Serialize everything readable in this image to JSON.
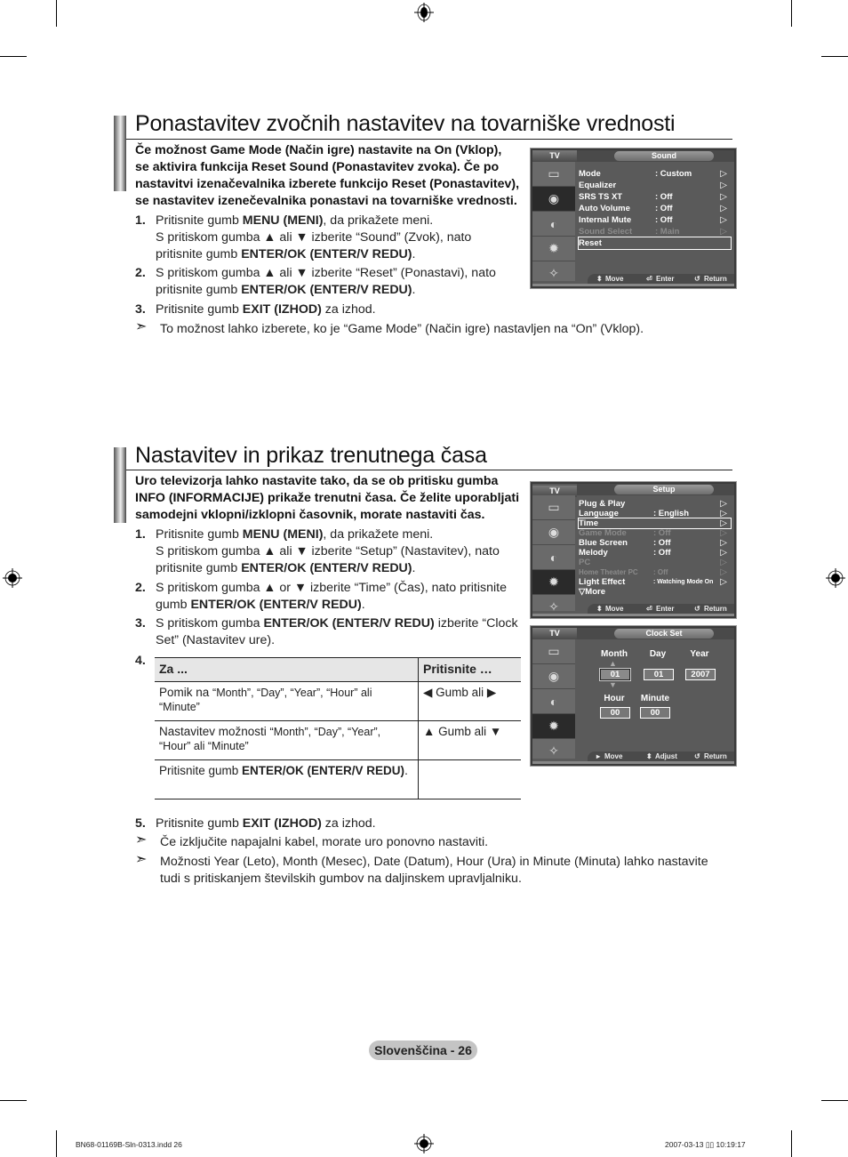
{
  "section1": {
    "title": "Ponastavitev zvočnih nastavitev na tovarniške vrednosti",
    "intro": [
      "Če možnost Game Mode (Način igre) nastavite na On (Vklop),",
      "se aktivira funkcija Reset Sound (Ponastavitev zvoka). Če po",
      "nastavitvi izenačevalnika izberete funkcijo Reset (Ponastavitev),",
      "se nastavitev izenečevalnika ponastavi na tovarniške vrednosti."
    ],
    "steps": [
      {
        "num": "1.",
        "lines": [
          {
            "pre": "Pritisnite gumb ",
            "bold": "MENU (MENI)",
            "post": ", da prikažete meni."
          },
          {
            "pre": "S pritiskom gumba ▲ ali ▼ izberite “Sound” (Zvok), nato",
            "bold": "",
            "post": ""
          },
          {
            "pre": "pritisnite gumb ",
            "bold": "ENTER/OK (ENTER/V REDU)",
            "post": "."
          }
        ]
      },
      {
        "num": "2.",
        "lines": [
          {
            "pre": "S pritiskom gumba ▲ ali ▼ izberite “Reset” (Ponastavi), nato",
            "bold": "",
            "post": ""
          },
          {
            "pre": "pritisnite gumb ",
            "bold": "ENTER/OK (ENTER/V REDU)",
            "post": "."
          }
        ]
      },
      {
        "num": "3.",
        "lines": [
          {
            "pre": "Pritisnite gumb ",
            "bold": "EXIT (IZHOD)",
            "post": " za izhod."
          }
        ]
      }
    ],
    "note": "To možnost lahko izberete, ko je “Game Mode” (Način igre) nastavljen na “On” (Vklop).",
    "osd": {
      "tab": "TV",
      "title": "Sound",
      "rows": [
        {
          "label": "Mode",
          "value": ": Custom",
          "chev": "▷",
          "state": "normal"
        },
        {
          "label": "Equalizer",
          "value": "",
          "chev": "▷",
          "state": "normal"
        },
        {
          "label": "SRS TS XT",
          "value": ": Off",
          "chev": "▷",
          "state": "normal"
        },
        {
          "label": "Auto Volume",
          "value": ": Off",
          "chev": "▷",
          "state": "normal"
        },
        {
          "label": "Internal Mute",
          "value": ": Off",
          "chev": "▷",
          "state": "normal"
        },
        {
          "label": "Sound Select",
          "value": ": Main",
          "chev": "▷",
          "state": "dim"
        },
        {
          "label": "Reset",
          "value": "",
          "chev": "",
          "state": "selected"
        }
      ],
      "footer": {
        "move": "Move",
        "enter": "Enter",
        "return": "Return"
      }
    }
  },
  "section2": {
    "title": "Nastavitev in prikaz trenutnega časa",
    "intro": [
      "Uro televizorja lahko nastavite tako, da se ob pritisku gumba",
      "INFO (INFORMACIJE) prikaže trenutni časa. Če želite uporabljati",
      "samodejni vklopni/izklopni časovnik, morate nastaviti čas."
    ],
    "steps": [
      {
        "num": "1.",
        "lines": [
          {
            "pre": "Pritisnite gumb ",
            "bold": "MENU (MENI)",
            "post": ", da prikažete meni."
          },
          {
            "pre": "S pritiskom gumba ▲ ali ▼ izberite “Setup” (Nastavitev), nato",
            "bold": "",
            "post": ""
          },
          {
            "pre": "pritisnite gumb ",
            "bold": "ENTER/OK (ENTER/V REDU)",
            "post": "."
          }
        ]
      },
      {
        "num": "2.",
        "lines": [
          {
            "pre": "S pritiskom gumba ▲ or ▼ izberite “Time” (Čas), nato pritisnite",
            "bold": "",
            "post": ""
          },
          {
            "pre": "gumb ",
            "bold": "ENTER/OK (ENTER/V REDU)",
            "post": "."
          }
        ]
      },
      {
        "num": "3.",
        "lines": [
          {
            "pre": "S pritiskom gumba ",
            "bold": "ENTER/OK (ENTER/V REDU)",
            "post": " izberite “Clock"
          },
          {
            "pre": "Set” (Nastavitev ure).",
            "bold": "",
            "post": ""
          }
        ]
      }
    ],
    "step4_num": "4.",
    "table": {
      "headers": [
        "Za ...",
        "Pritisnite …"
      ],
      "rows": [
        {
          "action_pre": "Pomik na ",
          "action_small": "“Month”, “Day”, “Year”, “Hour” ali “Minute”",
          "action_bold": "",
          "action_post": "",
          "press": "◀ Gumb ali ▶"
        },
        {
          "action_pre": "Nastavitev možnosti ",
          "action_small": "“Month”, “Day”, “Year”, “Hour” ali “Minute”",
          "action_bold": "",
          "action_post": "",
          "press": "▲ Gumb ali ▼"
        },
        {
          "action_pre": "Pritisnite gumb ",
          "action_small": "",
          "action_bold": "ENTER/OK (ENTER/V REDU)",
          "action_post": ".",
          "press": ""
        }
      ]
    },
    "step5": {
      "num": "5.",
      "pre": "Pritisnite gumb ",
      "bold": "EXIT (IZHOD)",
      "post": " za izhod."
    },
    "notes": [
      "Če izključite napajalni kabel, morate uro ponovno nastaviti.",
      "Možnosti Year (Leto), Month (Mesec), Date (Datum), Hour (Ura) in Minute (Minuta) lahko nastavite",
      "tudi s pritiskanjem številskih gumbov na daljinskem upravljalniku."
    ],
    "osd_setup": {
      "tab": "TV",
      "title": "Setup",
      "rows": [
        {
          "label": "Plug & Play",
          "value": "",
          "chev": "▷",
          "state": "normal"
        },
        {
          "label": "Language",
          "value": ": English",
          "chev": "▷",
          "state": "normal"
        },
        {
          "label": "Time",
          "value": "",
          "chev": "▷",
          "state": "selected"
        },
        {
          "label": "Game Mode",
          "value": ": Off",
          "chev": "▷",
          "state": "dim"
        },
        {
          "label": "Blue Screen",
          "value": ": Off",
          "chev": "▷",
          "state": "normal"
        },
        {
          "label": "Melody",
          "value": ": Off",
          "chev": "▷",
          "state": "normal"
        },
        {
          "label": "PC",
          "value": "",
          "chev": "▷",
          "state": "dim"
        },
        {
          "label": "Home Theater PC",
          "value": ": Off",
          "chev": "▷",
          "state": "dim"
        },
        {
          "label": "Light Effect",
          "value": ": Watching Mode On",
          "chev": "▷",
          "state": "normal"
        },
        {
          "label": "▽More",
          "value": "",
          "chev": "",
          "state": "normal"
        }
      ],
      "footer": {
        "move": "Move",
        "enter": "Enter",
        "return": "Return"
      }
    },
    "osd_clock": {
      "tab": "TV",
      "title": "Clock Set",
      "labels": {
        "month": "Month",
        "day": "Day",
        "year": "Year",
        "hour": "Hour",
        "minute": "Minute"
      },
      "values": {
        "month": "01",
        "day": "01",
        "year": "2007",
        "hour": "00",
        "minute": "00"
      },
      "footer": {
        "move": "Move",
        "adjust": "Adjust",
        "return": "Return"
      }
    }
  },
  "footer": {
    "page_label": "Slovenščina - 26",
    "slug_left": "BN68-01169B-Sln-0313.indd   26",
    "slug_right": "2007-03-13   ▯▯ 10:19:17"
  }
}
